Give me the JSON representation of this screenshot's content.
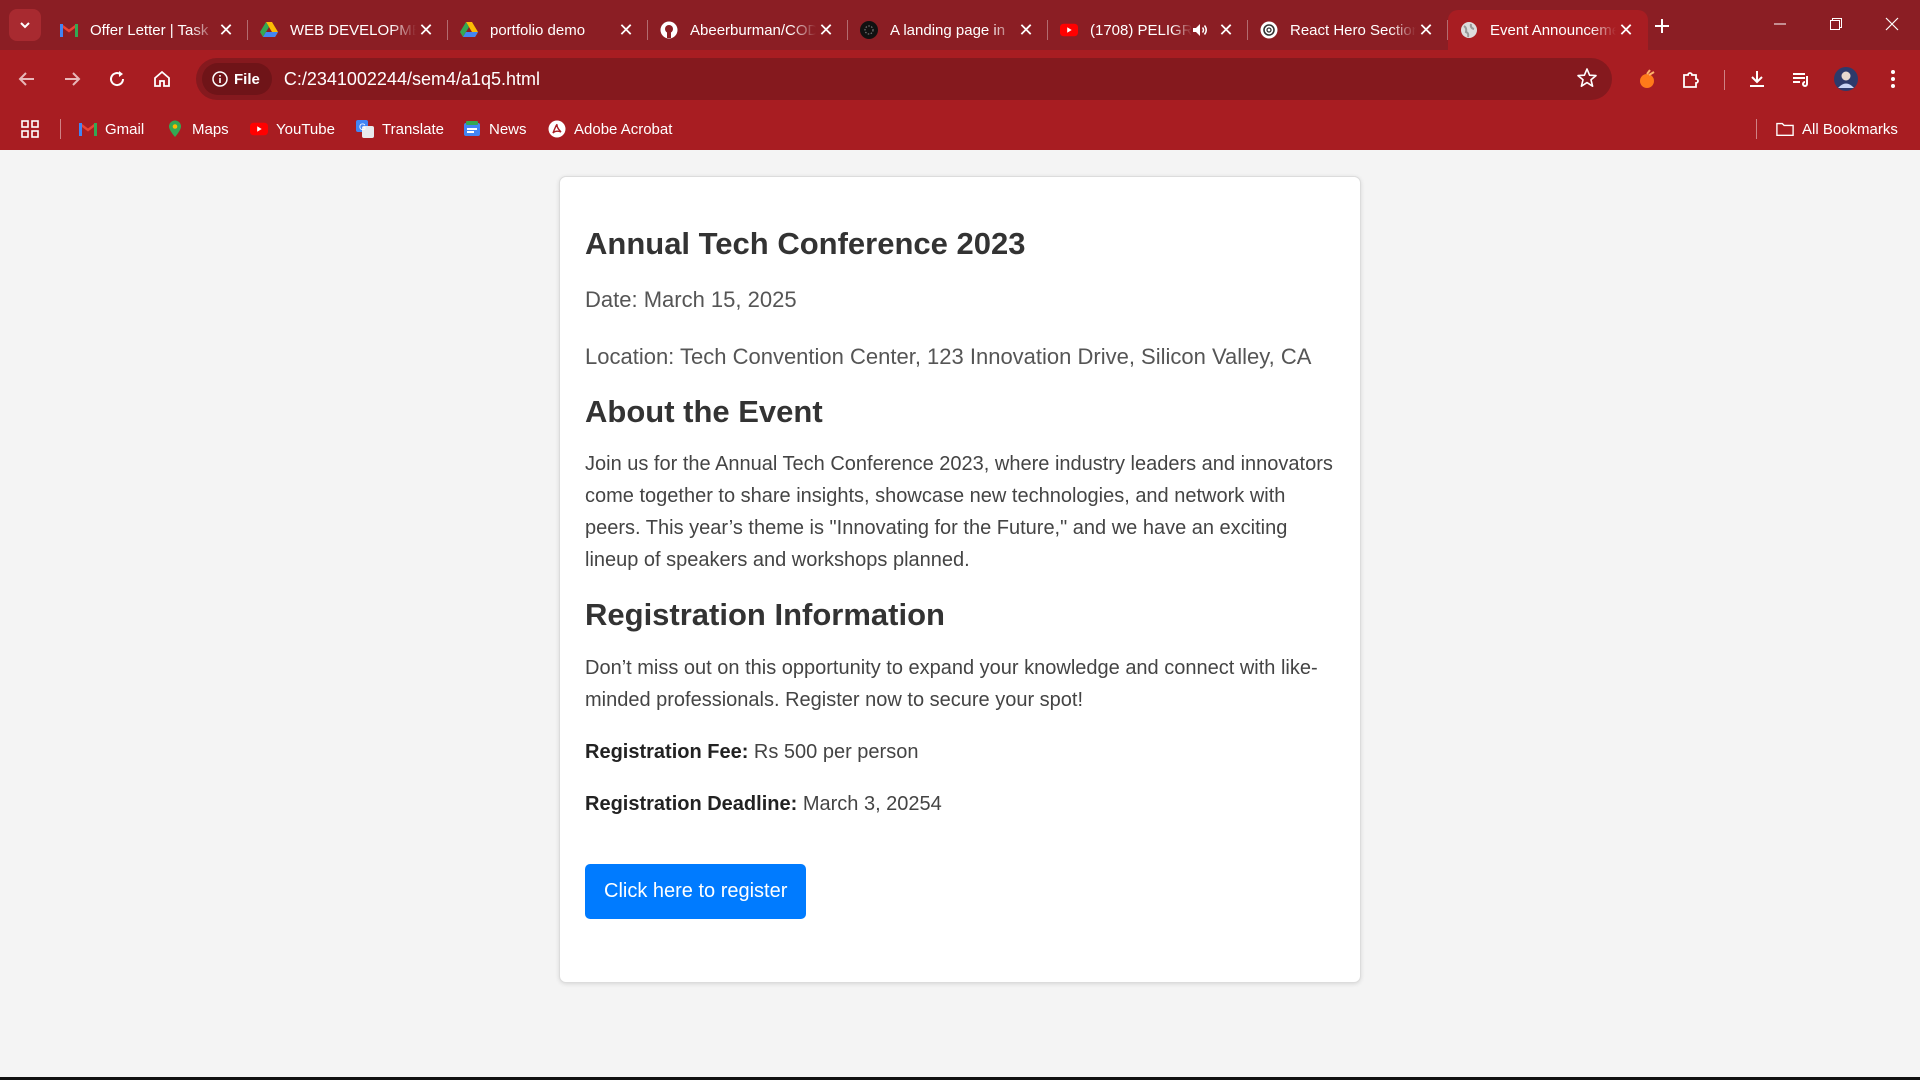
{
  "browser": {
    "tabs": [
      {
        "title": "Offer Letter | Task",
        "icon": "gmail-icon",
        "active": false
      },
      {
        "title": "WEB DEVELOPMENT",
        "icon": "google-drive-icon",
        "active": false
      },
      {
        "title": "portfolio demo",
        "icon": "google-drive-icon",
        "active": false
      },
      {
        "title": "Abeerburman/CODSOFT",
        "icon": "github-icon",
        "active": false
      },
      {
        "title": "A landing page in",
        "icon": "dark-circle-icon",
        "active": false
      },
      {
        "title": "(1708) PELIGRO",
        "icon": "youtube-icon",
        "active": false,
        "audio": true
      },
      {
        "title": "React Hero Section",
        "icon": "openai-icon",
        "active": false
      },
      {
        "title": "Event Announcement",
        "icon": "globe-icon",
        "active": true
      }
    ],
    "address": {
      "chip_label": "File",
      "url": "C:/2341002244/sem4/a1q5.html"
    },
    "bookmarks": [
      {
        "label": "Gmail",
        "icon": "gmail-icon"
      },
      {
        "label": "Maps",
        "icon": "maps-pin-icon"
      },
      {
        "label": "YouTube",
        "icon": "youtube-icon"
      },
      {
        "label": "Translate",
        "icon": "translate-icon"
      },
      {
        "label": "News",
        "icon": "news-icon"
      },
      {
        "label": "Adobe Acrobat",
        "icon": "acrobat-icon"
      }
    ],
    "all_bookmarks_label": "All Bookmarks",
    "colors": {
      "frame": "#8b1e24",
      "toolbar": "#a81d22",
      "omnibox": "#85191e"
    }
  },
  "event": {
    "title": "Annual Tech Conference 2023",
    "date": "Date: March 15, 2025",
    "location": "Location: Tech Convention Center, 123 Innovation Drive, Silicon Valley, CA",
    "about_heading": "About the Event",
    "about_text": "Join us for the Annual Tech Conference 2023, where industry leaders and innovators come together to share insights, showcase new technologies, and network with peers. This year’s theme is \"Innovating for the Future,\" and we have an exciting lineup of speakers and workshops planned.",
    "registration_heading": "Registration Information",
    "registration_text": "Don’t miss out on this opportunity to expand your knowledge and connect with like-minded professionals. Register now to secure your spot!",
    "fee_label": "Registration Fee:",
    "fee_value": " Rs 500 per person",
    "deadline_label": "Registration Deadline:",
    "deadline_value": " March 3, 20254",
    "register_button": "Click here to register",
    "button_color": "#007bff"
  }
}
